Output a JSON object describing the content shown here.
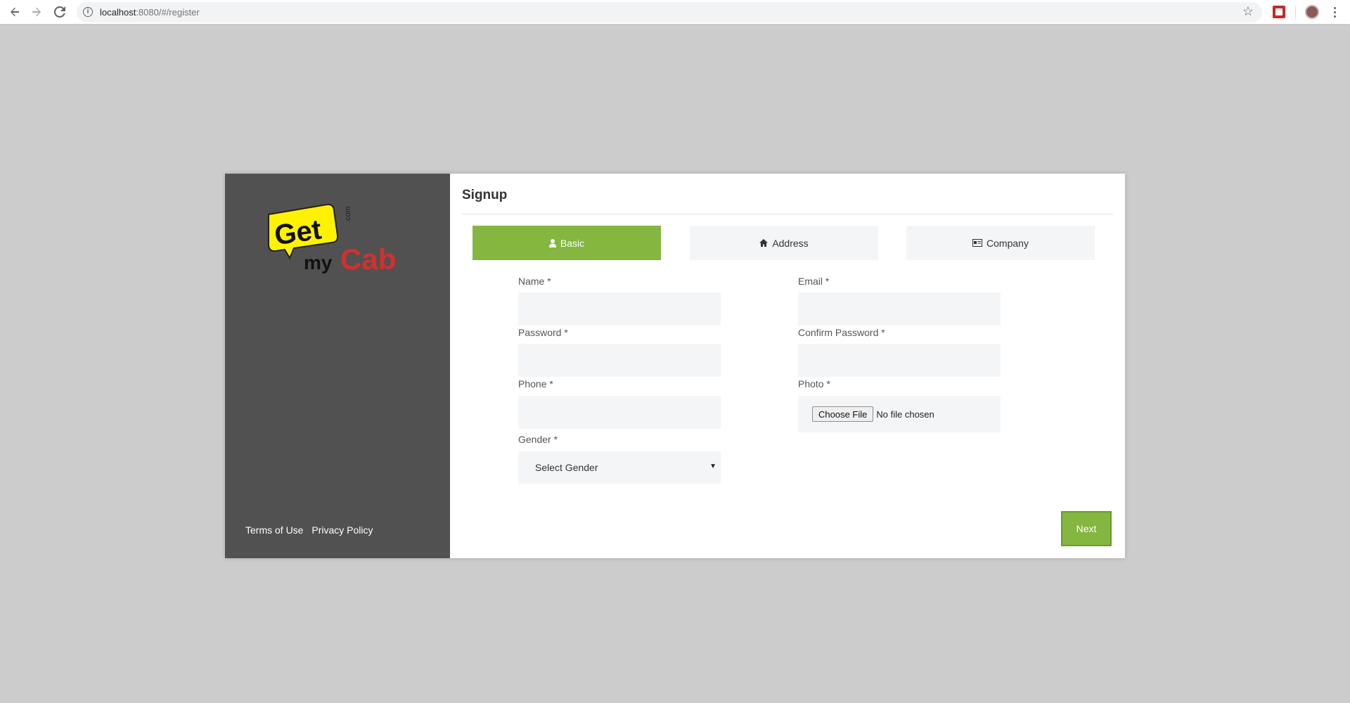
{
  "browser": {
    "url_host": "localhost",
    "url_rest": ":8080/#/register"
  },
  "sidebar": {
    "logo": {
      "word1": "Get",
      "word2": "my",
      "word3": "Cab",
      "suffix": ".com"
    },
    "footer": {
      "terms": "Terms of Use",
      "privacy": "Privacy Policy"
    }
  },
  "form": {
    "title": "Signup",
    "tabs": [
      {
        "label": "Basic",
        "icon": "user-icon",
        "active": true
      },
      {
        "label": "Address",
        "icon": "home-icon",
        "active": false
      },
      {
        "label": "Company",
        "icon": "id-card-icon",
        "active": false
      }
    ],
    "fields": {
      "name": {
        "label": "Name *",
        "value": ""
      },
      "email": {
        "label": "Email *",
        "value": ""
      },
      "password": {
        "label": "Password *",
        "value": ""
      },
      "confirm_password": {
        "label": "Confirm Password *",
        "value": ""
      },
      "phone": {
        "label": "Phone *",
        "value": ""
      },
      "photo": {
        "label": "Photo *",
        "button": "Choose File",
        "status": "No file chosen"
      },
      "gender": {
        "label": "Gender *",
        "selected": "Select Gender"
      }
    },
    "next_label": "Next"
  },
  "colors": {
    "accent": "#84b640",
    "sidebar": "#515151",
    "page_bg": "#cccccc",
    "field_bg": "#f4f5f7"
  }
}
